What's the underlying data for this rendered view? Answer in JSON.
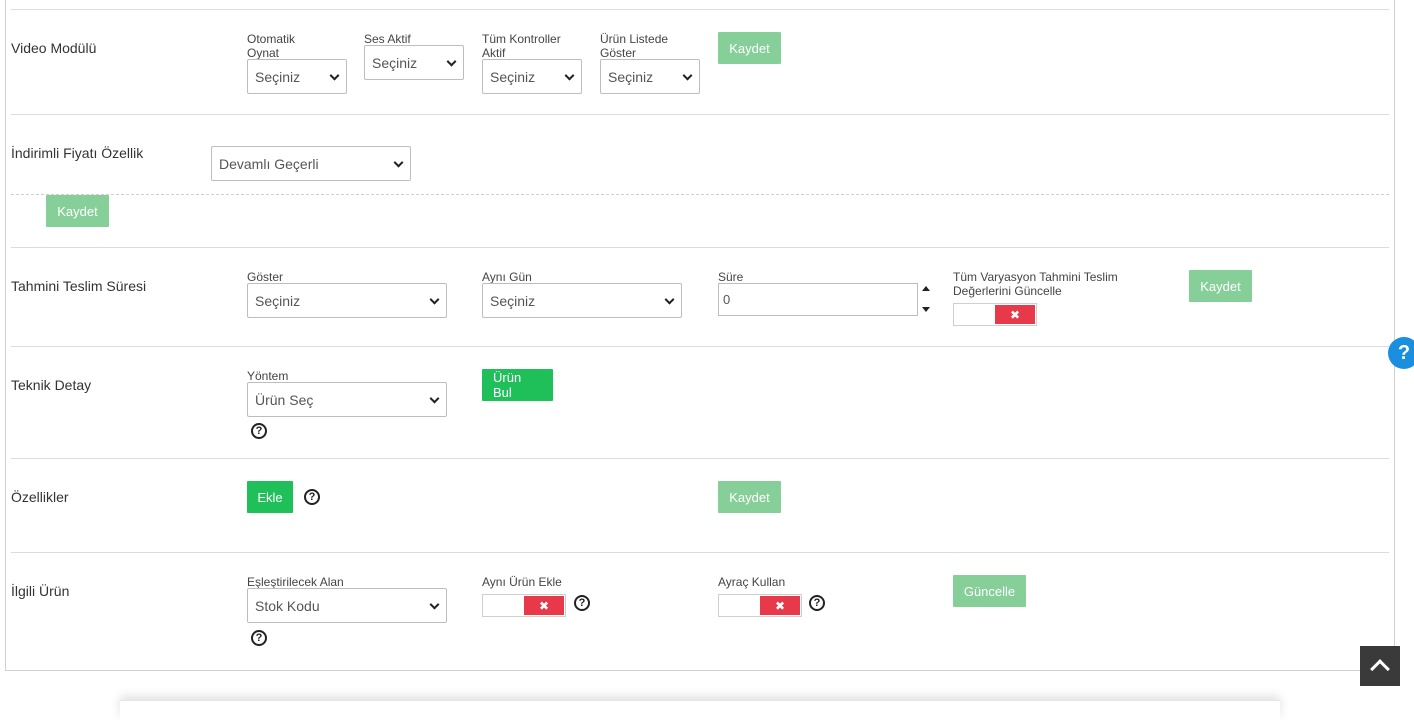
{
  "placeholder_select": "Seçiniz",
  "video": {
    "title": "Video Modülü",
    "fields": [
      {
        "label": "Otomatik Oynat",
        "value": "Seçiniz"
      },
      {
        "label": "Ses Aktif",
        "value": "Seçiniz"
      },
      {
        "label": "Tüm Kontroller Aktif",
        "value": "Seçiniz"
      },
      {
        "label": "Ürün Listede Göster",
        "value": "Seçiniz"
      }
    ],
    "save_label": "Kaydet"
  },
  "discount": {
    "title": "İndirimli Fiyatı Özellik",
    "value": "Devamlı Geçerli",
    "save_label": "Kaydet"
  },
  "delivery": {
    "title": "Tahmini Teslim Süresi",
    "show_label": "Göster",
    "show_value": "Seçiniz",
    "same_day_label": "Aynı Gün",
    "same_day_value": "Seçiniz",
    "duration_label": "Süre",
    "duration_value": "0",
    "update_all_label": "Tüm Varyasyon Tahmini Teslim Değerlerini Güncelle",
    "save_label": "Kaydet"
  },
  "technical": {
    "title": "Teknik Detay",
    "method_label": "Yöntem",
    "method_value": "Ürün Seç",
    "find_label": "Ürün Bul"
  },
  "features": {
    "title": "Özellikler",
    "add_label": "Ekle",
    "save_label": "Kaydet"
  },
  "related": {
    "title": "İlgili Ürün",
    "match_label": "Eşleştirilecek Alan",
    "match_value": "Stok Kodu",
    "same_product_label": "Aynı Ürün Ekle",
    "separator_label": "Ayraç Kullan",
    "update_label": "Güncelle"
  },
  "icons": {
    "help": "question-circle-icon",
    "toggle_off": "x-icon",
    "scroll_top": "chevron-up-icon",
    "help_fab": "help-fab-icon"
  },
  "colors": {
    "button_light": "#86cf99",
    "button_strong": "#1fbf5a",
    "toggle_off": "#e8394a",
    "help_fab": "#1a8fe0"
  }
}
